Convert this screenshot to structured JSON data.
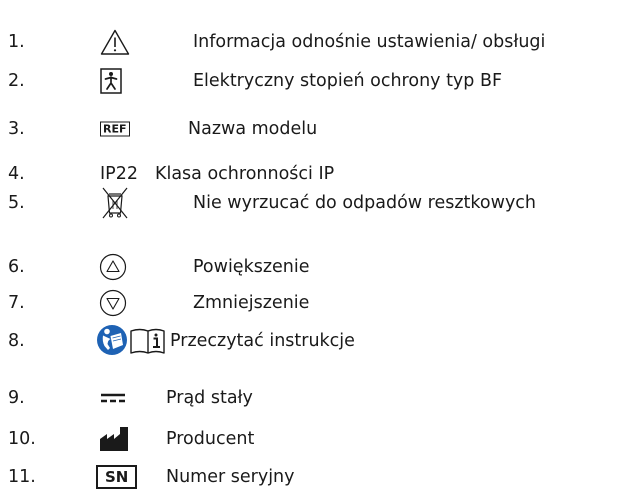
{
  "items": [
    {
      "number": "1.",
      "symbol": "warning-triangle-icon",
      "label": "Informacja odnośnie ustawienia/ obsługi"
    },
    {
      "number": "2.",
      "symbol": "bf-applied-part-icon",
      "label": "Elektryczny stopień ochrony typ BF"
    },
    {
      "number": "3.",
      "symbol": "ref-icon",
      "symbol_text": "REF",
      "label": "Nazwa modelu"
    },
    {
      "number": "4.",
      "symbol": "ip-class-text",
      "symbol_text": "IP22",
      "label": "Klasa ochronności IP"
    },
    {
      "number": "5.",
      "symbol": "crossed-bin-icon",
      "label": "Nie wyrzucać do odpadów resztkowych"
    },
    {
      "number": "6.",
      "symbol": "circle-triangle-up-icon",
      "label": "Powiększenie"
    },
    {
      "number": "7.",
      "symbol": "circle-triangle-down-icon",
      "label": "Zmniejszenie"
    },
    {
      "number": "8.",
      "symbol": "read-instructions-icon",
      "label": "Przeczytać instrukcje"
    },
    {
      "number": "9.",
      "symbol": "direct-current-icon",
      "label": "Prąd stały"
    },
    {
      "number": "10.",
      "symbol": "manufacturer-icon",
      "label": "Producent"
    },
    {
      "number": "11.",
      "symbol": "sn-icon",
      "symbol_text": "SN",
      "label": "Numer seryjny"
    }
  ]
}
